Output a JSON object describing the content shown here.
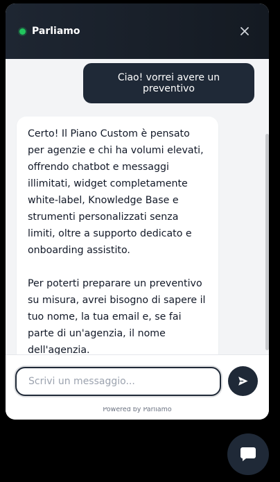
{
  "header": {
    "title": "Parliamo",
    "status_color": "#22c55e",
    "close_icon": "close-icon"
  },
  "messages": [
    {
      "role": "user",
      "text": "Ciao! vorrei avere un preventivo"
    },
    {
      "role": "assistant",
      "paragraphs": [
        "Certo! Il Piano Custom è pensato per agenzie e chi ha volumi elevati, offrendo chatbot e messaggi illimitati, widget completamente white-label, Knowledge Base e strumenti personalizzati senza limiti, oltre a supporto dedicato e onboarding assistito.",
        "Per poterti preparare un preventivo su misura, avrei bisogno di sapere il tuo nome, la tua email e, se fai parte di un'agenzia, il nome dell'agenzia."
      ]
    }
  ],
  "composer": {
    "placeholder": "Scrivi un messaggio...",
    "value": "",
    "send_icon": "send-icon"
  },
  "footer": {
    "powered_by": "Powered by Parliamo"
  },
  "launcher": {
    "icon": "chat-bubble-icon"
  },
  "colors": {
    "primary": "#1f2937",
    "header_bg": "#1a212b",
    "messages_bg": "#f3f4f6"
  }
}
